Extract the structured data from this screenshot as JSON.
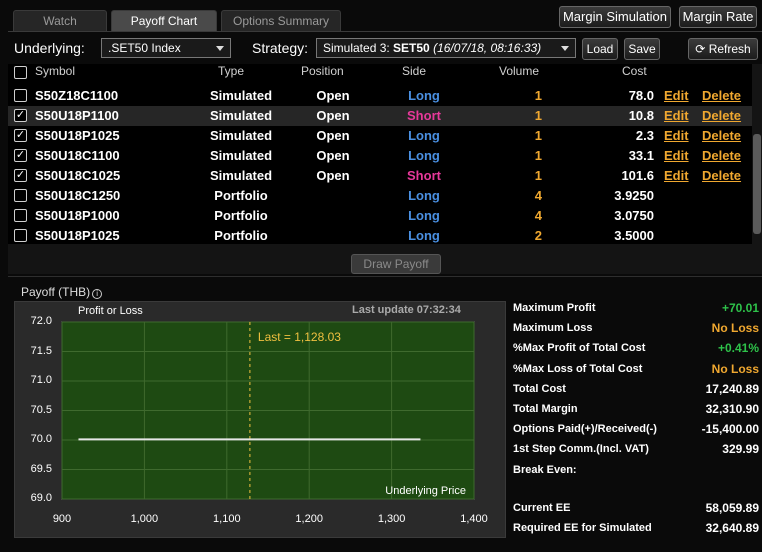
{
  "tabs": [
    {
      "label": "Watch",
      "active": false
    },
    {
      "label": "Payoff Chart",
      "active": true
    },
    {
      "label": "Options Summary",
      "active": false
    }
  ],
  "top_buttons": {
    "margin_simulation": "Margin Simulation",
    "margin_rate": "Margin Rate"
  },
  "toolbar": {
    "underlying_label": "Underlying:",
    "underlying_value": ".SET50 Index",
    "strategy_label": "Strategy:",
    "strategy_prefix": "Simulated 3: ",
    "strategy_name": "SET50",
    "strategy_time": "(16/07/18, 08:16:33)",
    "load": "Load",
    "save": "Save",
    "refresh": "Refresh"
  },
  "table": {
    "headers": [
      "Symbol",
      "Type",
      "Position",
      "Side",
      "Volume",
      "Cost"
    ],
    "edit_label": "Edit",
    "delete_label": "Delete",
    "rows": [
      {
        "symbol": "S50Z18C1100",
        "type": "Simulated",
        "position": "Open",
        "side": "Long",
        "volume": "1",
        "cost": "78.0",
        "checked": false,
        "editable": true,
        "highlight": false
      },
      {
        "symbol": "S50U18P1100",
        "type": "Simulated",
        "position": "Open",
        "side": "Short",
        "volume": "1",
        "cost": "10.8",
        "checked": true,
        "editable": true,
        "highlight": true
      },
      {
        "symbol": "S50U18P1025",
        "type": "Simulated",
        "position": "Open",
        "side": "Long",
        "volume": "1",
        "cost": "2.3",
        "checked": true,
        "editable": true,
        "highlight": false
      },
      {
        "symbol": "S50U18C1100",
        "type": "Simulated",
        "position": "Open",
        "side": "Long",
        "volume": "1",
        "cost": "33.1",
        "checked": true,
        "editable": true,
        "highlight": false
      },
      {
        "symbol": "S50U18C1025",
        "type": "Simulated",
        "position": "Open",
        "side": "Short",
        "volume": "1",
        "cost": "101.6",
        "checked": true,
        "editable": true,
        "highlight": false
      },
      {
        "symbol": "S50U18C1250",
        "type": "Portfolio",
        "position": "",
        "side": "Long",
        "volume": "4",
        "cost": "3.9250",
        "checked": false,
        "editable": false,
        "highlight": false
      },
      {
        "symbol": "S50U18P1000",
        "type": "Portfolio",
        "position": "",
        "side": "Long",
        "volume": "4",
        "cost": "3.0750",
        "checked": false,
        "editable": false,
        "highlight": false
      },
      {
        "symbol": "S50U18P1025",
        "type": "Portfolio",
        "position": "",
        "side": "Long",
        "volume": "2",
        "cost": "3.5000",
        "checked": false,
        "editable": false,
        "highlight": false
      }
    ]
  },
  "draw_payoff": "Draw Payoff",
  "payoff": {
    "panel_title": "Payoff (THB)",
    "last_update": "Last update 07:32:34"
  },
  "chart_data": {
    "type": "line",
    "title": "Profit or Loss",
    "xlabel": "Underlying Price",
    "ylabel": "Profit or Loss",
    "xlim": [
      900,
      1400
    ],
    "ylim": [
      69.0,
      72.0
    ],
    "x_ticks": [
      "900",
      "1,000",
      "1,100",
      "1,200",
      "1,300",
      "1,400"
    ],
    "y_ticks": [
      "72.0",
      "71.5",
      "71.0",
      "70.5",
      "70.0",
      "69.5",
      "69.0"
    ],
    "series": [
      {
        "x": [
          920,
          1335
        ],
        "y": [
          70.01,
          70.01
        ]
      }
    ],
    "marker": {
      "label": "Last = 1,128.03",
      "x": 1128.03
    },
    "grid": true,
    "background": "#1e4a12",
    "line_color": "#e6e6e6"
  },
  "stats": [
    {
      "label": "Maximum Profit",
      "value": "+70.01",
      "color": "green"
    },
    {
      "label": "Maximum Loss",
      "value": "No Loss",
      "color": "orange"
    },
    {
      "label": "%Max Profit of Total Cost",
      "value": "+0.41%",
      "color": "green"
    },
    {
      "label": "%Max Loss of Total Cost",
      "value": "No Loss",
      "color": "orange"
    },
    {
      "label": "Total Cost",
      "value": "17,240.89",
      "color": "white"
    },
    {
      "label": "Total Margin",
      "value": "32,310.90",
      "color": "white"
    },
    {
      "label": "Options Paid(+)/Received(-)",
      "value": "-15,400.00",
      "color": "white"
    },
    {
      "label": "1st Step Comm.(Incl. VAT)",
      "value": "329.99",
      "color": "white"
    },
    {
      "label": "Break Even:",
      "value": "",
      "color": "white"
    }
  ],
  "ee": [
    {
      "label": "Current EE",
      "value": "58,059.89"
    },
    {
      "label": "Required EE for Simulated",
      "value": "32,640.89"
    }
  ]
}
